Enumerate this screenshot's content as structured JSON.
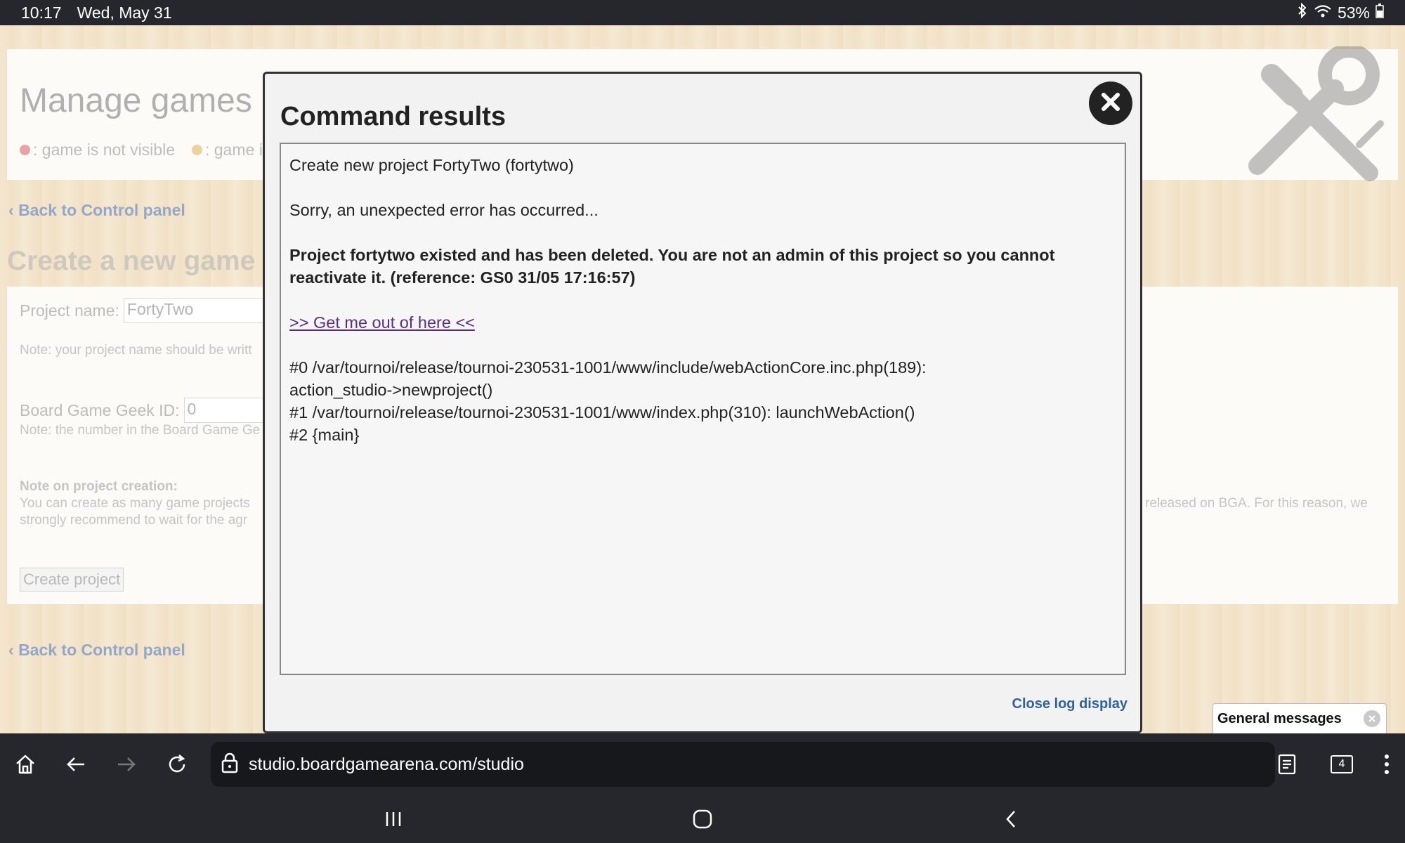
{
  "status_bar": {
    "time": "10:17",
    "date": "Wed, May 31",
    "battery": "53%"
  },
  "background": {
    "title": "Manage games",
    "legend": [
      {
        "color": "#e8a3a3",
        "label": ": game is not visible"
      },
      {
        "color": "#ecd39c",
        "label": ": game i"
      }
    ],
    "back_link": "Back to Control panel",
    "section_title": "Create a new game",
    "project_name_label": "Project name:",
    "project_name_value": "FortyTwo",
    "project_name_note": "Note: your project name should be writt",
    "bgg_label": "Board Game Geek ID:",
    "bgg_value": "0",
    "bgg_note": "Note: the number in the Board Game Ge",
    "creation_note_title": "Note on project creation:",
    "creation_note_line1": "You can create as many game projects",
    "creation_note_line2": "strongly recommend to wait for the agr",
    "creation_note_right": "released on BGA. For this reason, we",
    "create_button": "Create project",
    "back_link_bottom": "Back to Control panel"
  },
  "modal": {
    "title": "Command results",
    "log_lines": {
      "line1": "Create new project FortyTwo (fortytwo)",
      "line2": "Sorry, an unexpected error has occurred...",
      "error": "Project fortytwo existed and has been deleted. You are not an admin of this project so you cannot reactivate it. (reference: GS0 31/05 17:16:57)",
      "escape_link": ">> Get me out of here <<",
      "trace0": "#0 /var/tournoi/release/tournoi-230531-1001/www/include/webActionCore.inc.php(189):",
      "trace0b": "action_studio->newproject()",
      "trace1": "#1 /var/tournoi/release/tournoi-230531-1001/www/index.php(310): launchWebAction()",
      "trace2": "#2 {main}"
    },
    "close_log_label": "Close log display"
  },
  "general_messages": {
    "label": "General messages"
  },
  "browser": {
    "url": "studio.boardgamearena.com/studio",
    "tab_count": "4"
  },
  "icons": {
    "home": "home-icon",
    "back": "back-arrow-icon",
    "forward": "forward-arrow-icon",
    "reload": "reload-icon",
    "lock": "lock-icon",
    "reader": "reader-mode-icon",
    "tabs": "tabs-icon",
    "menu": "more-vert-icon",
    "close": "close-icon",
    "wrench": "wrench-icon"
  }
}
